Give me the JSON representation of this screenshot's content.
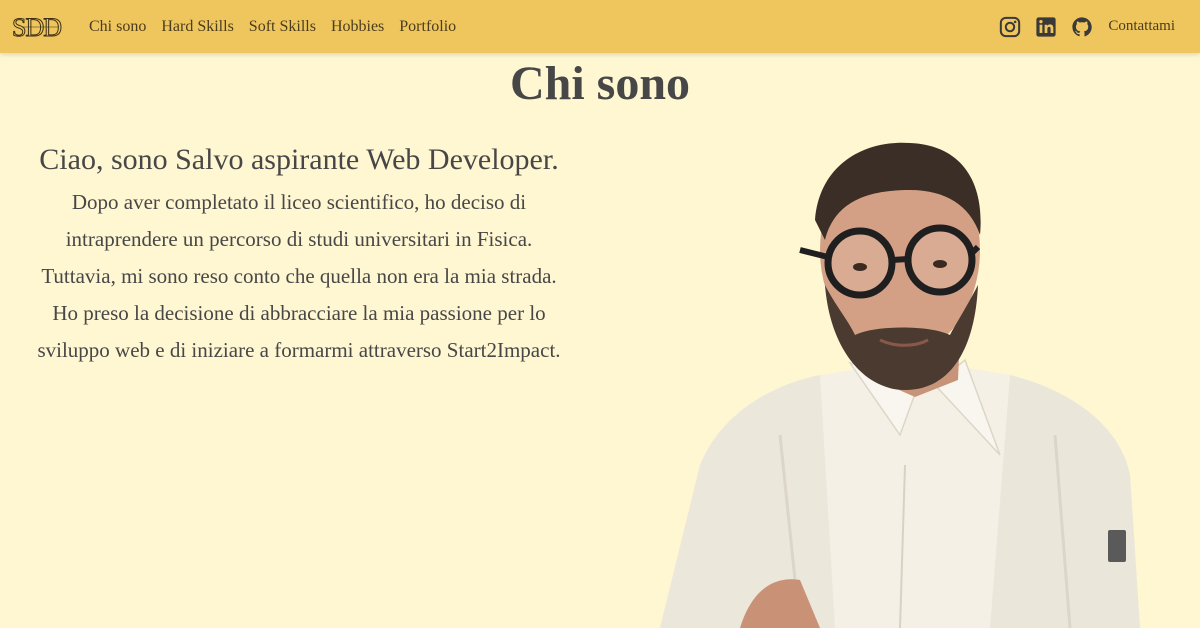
{
  "navbar": {
    "logo_text": "SDD",
    "links": [
      "Chi sono",
      "Hard Skills",
      "Soft Skills",
      "Hobbies",
      "Portfolio"
    ],
    "social_icons": [
      "instagram-icon",
      "linkedin-icon",
      "github-icon"
    ],
    "contact_label": "Contattami"
  },
  "main": {
    "title": "Chi sono",
    "intro_heading": "Ciao, sono Salvo aspirante Web Developer.",
    "intro_lines": [
      "Dopo aver completato il liceo scientifico, ho deciso di",
      "intraprendere un percorso di studi universitari in Fisica.",
      "Tuttavia, mi sono reso conto che quella non era la mia strada.",
      "Ho preso la decisione di abbracciare la mia passione per lo",
      "sviluppo web e di iniziare a formarmi attraverso Start2Impact."
    ]
  },
  "colors": {
    "navbar_bg": "#efc65d",
    "page_bg": "#fff6d2",
    "text": "#474747"
  }
}
